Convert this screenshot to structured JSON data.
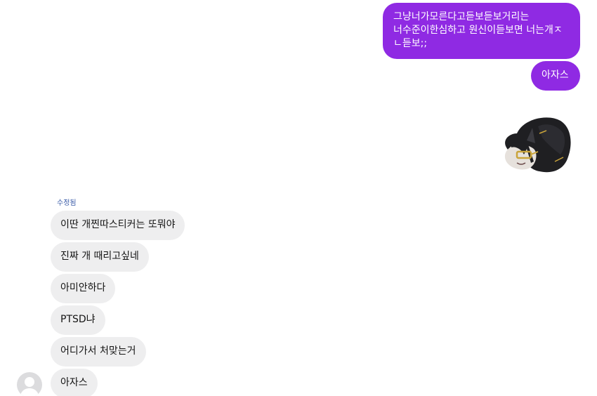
{
  "colors": {
    "outgoing_bubble": "#8f2ae3",
    "incoming_bubble": "#eeeeef",
    "edited_label": "#3b5ca8"
  },
  "outgoing": [
    {
      "text": "그냥너가모른다고듣보듣보거리는\n너수준이한심하고 원신이듣보면 너는개ㅈ\nㄴ듣보;;"
    },
    {
      "text": "아자스"
    }
  ],
  "sticker": {
    "icon": "plush-character-sticker-icon"
  },
  "incoming": {
    "edited_label": "수정됨",
    "messages": [
      {
        "text": "이딴 개찐따스티커는 또뭐야"
      },
      {
        "text": "진짜 개 때리고싶네"
      },
      {
        "text": "아미안하다"
      },
      {
        "text": "PTSD냐"
      },
      {
        "text": "어디가서 처맞는거"
      },
      {
        "text": "아자스"
      }
    ],
    "avatar_icon": "default-user-avatar-icon"
  }
}
